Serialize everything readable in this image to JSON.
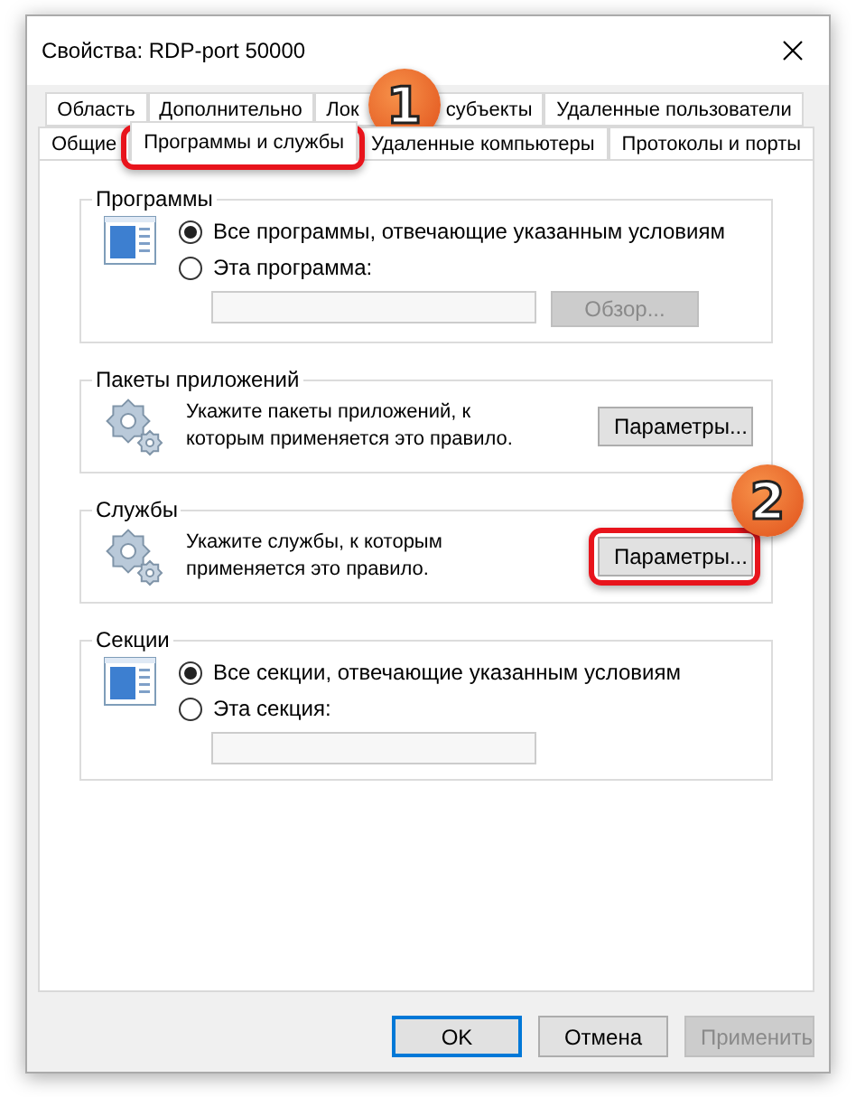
{
  "window": {
    "title": "Свойства: RDP-port 50000"
  },
  "tab_rows": [
    [
      {
        "label": "Область",
        "selected": false
      },
      {
        "label": "Дополнительно",
        "selected": false
      },
      {
        "label_parts": [
          "Лок",
          "субъекты"
        ],
        "selected": false
      },
      {
        "label": "Удаленные пользователи",
        "selected": false
      }
    ],
    [
      {
        "label": "Общие",
        "selected": false
      },
      {
        "label": "Программы и службы",
        "selected": true,
        "callout": "1"
      },
      {
        "label": "Удаленные компьютеры",
        "selected": false
      },
      {
        "label": "Протоколы и порты",
        "selected": false
      }
    ]
  ],
  "groups": [
    {
      "kind": "radio",
      "title": "Программы",
      "options": [
        {
          "label": "Все программы, отвечающие указанным условиям",
          "selected": true
        },
        {
          "label": "Эта программа:",
          "selected": false
        }
      ],
      "field": {
        "disabled": true
      },
      "browse_button": {
        "label": "Обзор...",
        "disabled": true
      }
    },
    {
      "kind": "settings",
      "title": "Пакеты приложений",
      "text": "Укажите пакеты приложений, к которым применяется это правило.",
      "button": {
        "label": "Параметры..."
      }
    },
    {
      "kind": "settings",
      "title": "Службы",
      "text": "Укажите службы, к которым применяется это правило.",
      "button": {
        "label": "Параметры...",
        "callout": "2"
      }
    },
    {
      "kind": "radio",
      "title": "Секции",
      "options": [
        {
          "label": "Все секции, отвечающие указанным условиям",
          "selected": true
        },
        {
          "label": "Эта секция:",
          "selected": false
        }
      ],
      "field": {
        "disabled": true
      }
    }
  ],
  "buttons": [
    {
      "label": "OK",
      "default": true,
      "disabled": false
    },
    {
      "label": "Отмена",
      "default": false,
      "disabled": false
    },
    {
      "label": "Применить",
      "default": false,
      "disabled": true
    }
  ]
}
